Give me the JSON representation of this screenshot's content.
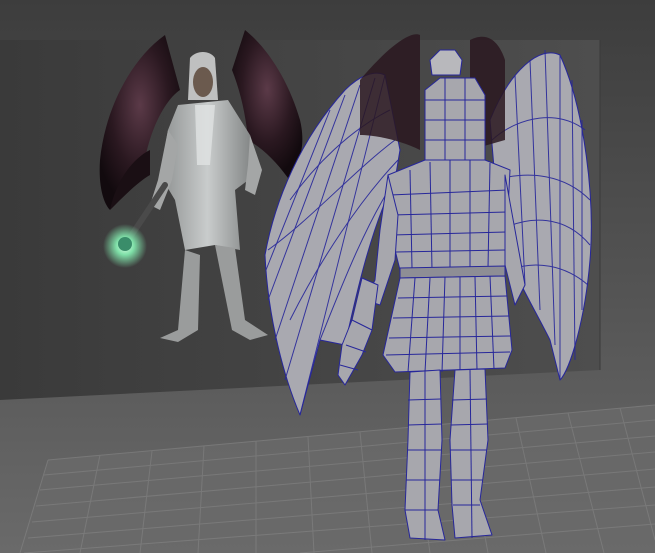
{
  "viewport": {
    "title": "",
    "background_color": "#5c5c5c",
    "floor_color": "#6b6b6b",
    "grid_color": "#7e7e7e",
    "wall_color": "#4a4a4a",
    "wireframe_color": "#2a2a9a",
    "mesh_fill_color": "#a7a7ad"
  },
  "scene": {
    "reference_image": "concept-art-winged-angel-character",
    "model": "angel-character-polygon-mesh-wireframe"
  }
}
